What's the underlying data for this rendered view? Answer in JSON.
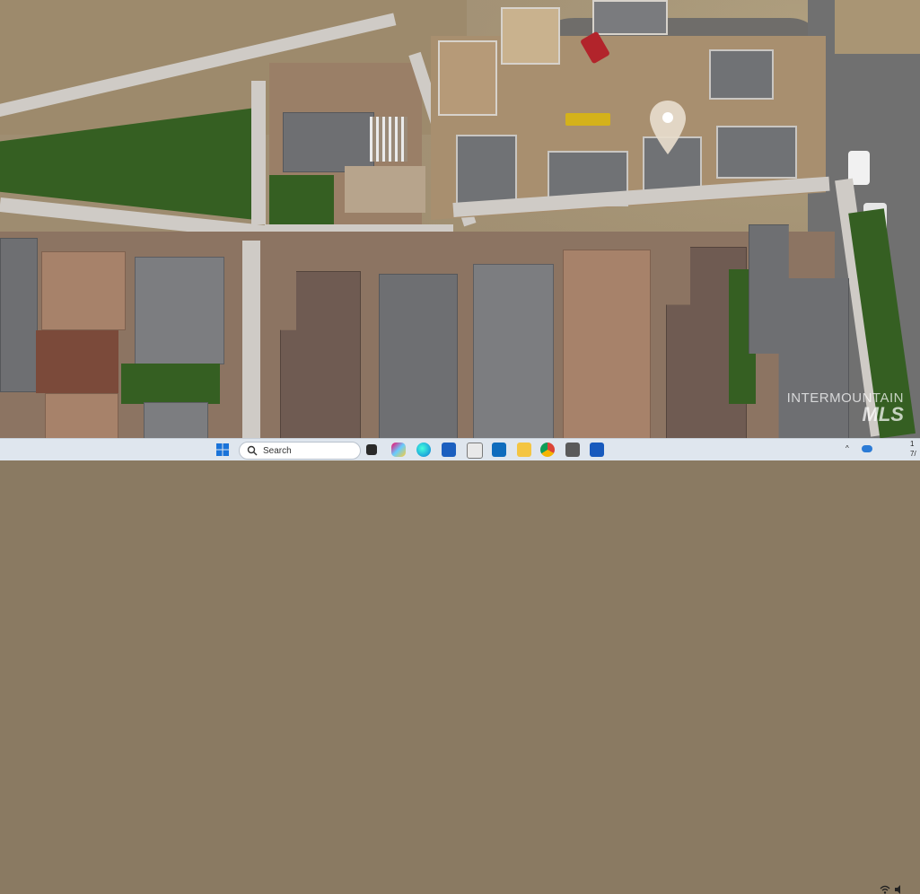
{
  "watermark": {
    "line1": "INTERMOUNTAIN",
    "line2": "MLS"
  },
  "taskbar": {
    "search_placeholder": "Search",
    "pinned_icons": [
      "windows-start-icon",
      "search-icon",
      "task-view-icon",
      "copilot-icon",
      "edge-icon",
      "store-icon",
      "snipping-tool-icon",
      "outlook-icon",
      "file-explorer-icon",
      "chrome-icon",
      "calculator-icon",
      "word-icon"
    ],
    "tray": {
      "chevron": "^",
      "clock_partial": "1",
      "date_partial": "7/"
    }
  },
  "colors": {
    "taskbar_bg": "#dfe6ee",
    "grass": "#355f22",
    "pin": "#e7dccc"
  }
}
